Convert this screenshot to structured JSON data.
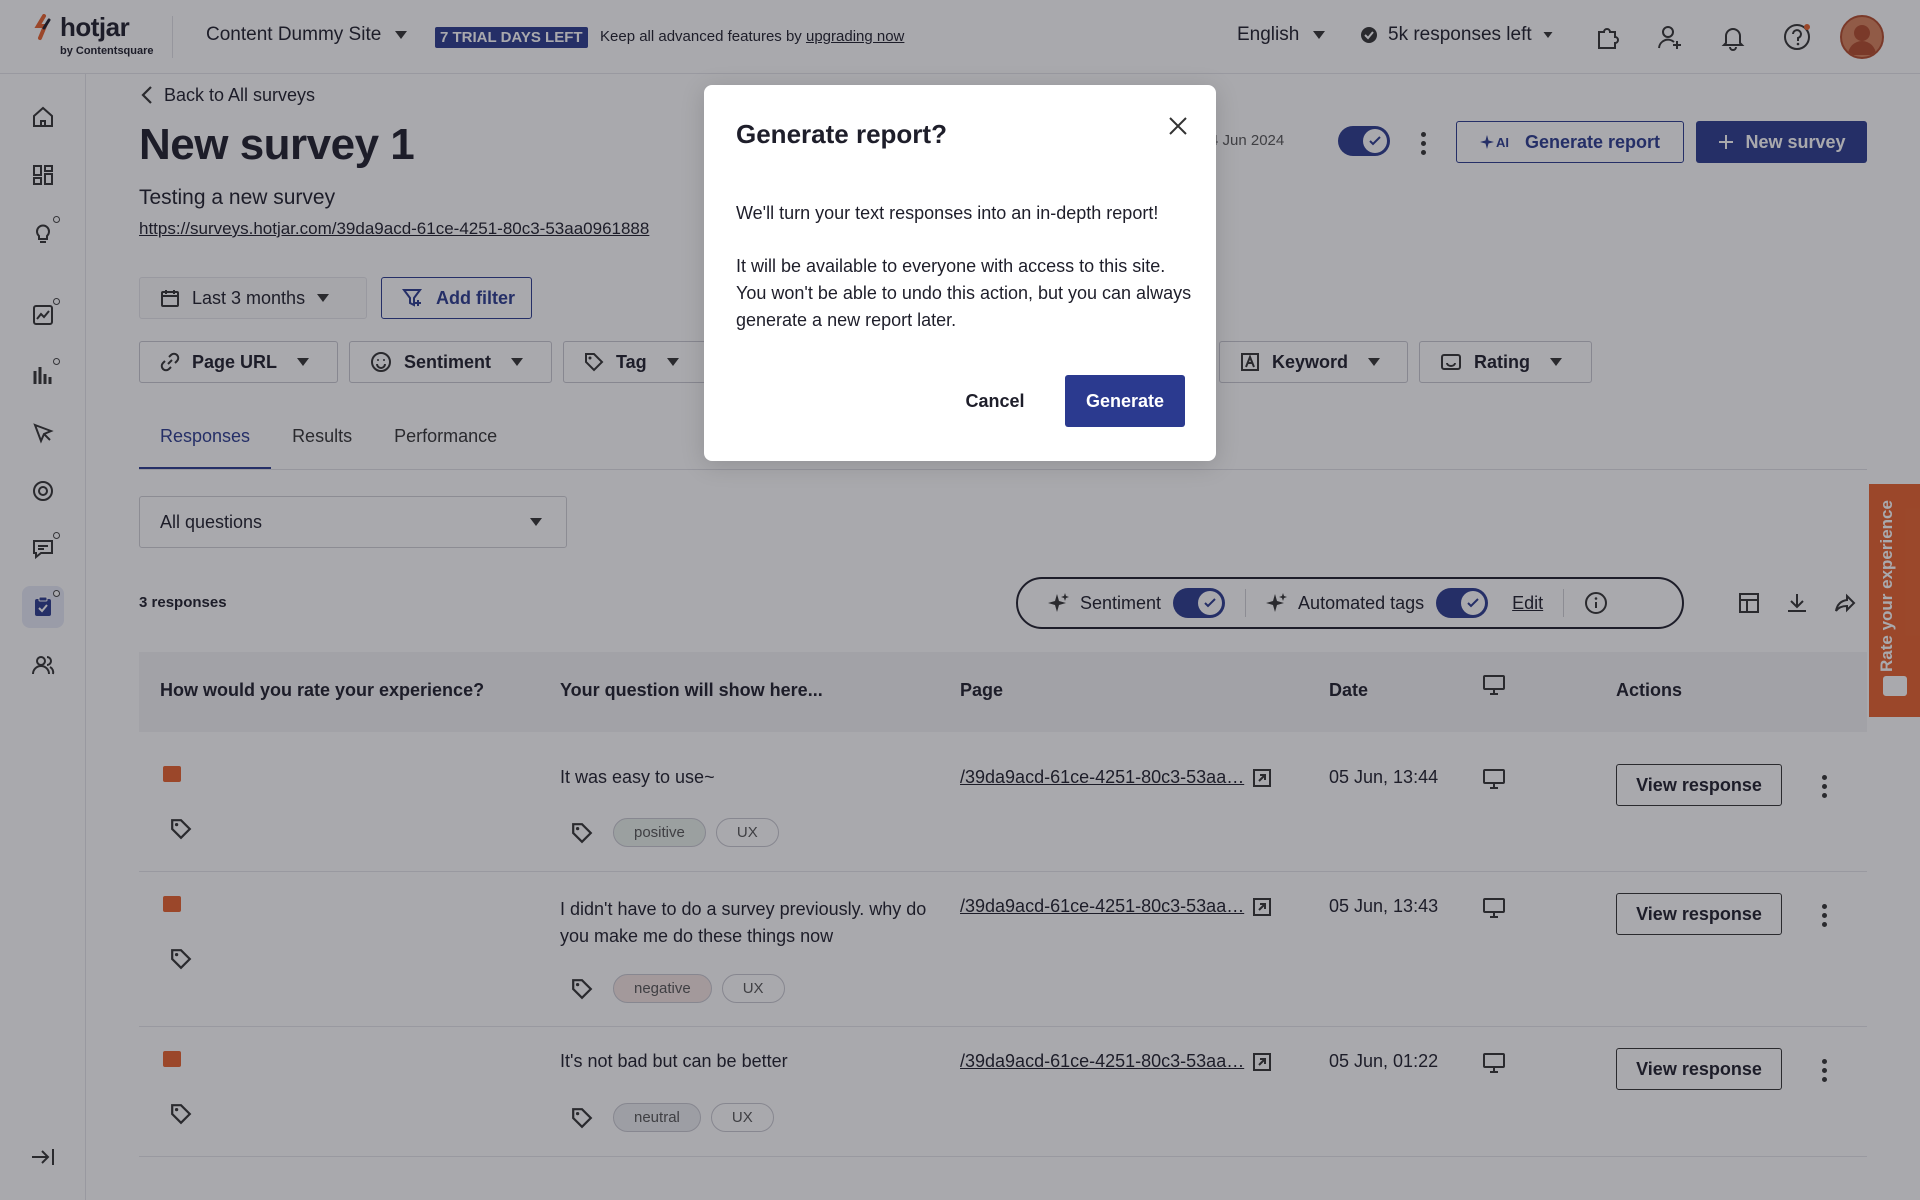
{
  "topbar": {
    "brand": "hotjar",
    "brand_sub": "by Contentsquare",
    "site_name": "Content Dummy Site",
    "trial_badge": "7 TRIAL DAYS LEFT",
    "trial_text": "Keep all advanced features by ",
    "trial_link": "upgrading now",
    "language": "English",
    "responses_left": "5k responses left"
  },
  "survey": {
    "back_label": "Back to All surveys",
    "title": "New survey 1",
    "subtitle": "Testing a new survey",
    "url": "https://surveys.hotjar.com/39da9acd-61ce-4251-80c3-53aa0961888",
    "date_fragment": "4 Jun 2024",
    "generate_report_label": "Generate report",
    "ai_label": "AI",
    "new_survey_label": "New survey"
  },
  "filters": {
    "date_range": "Last 3 months",
    "add_filter": "Add filter",
    "chips": [
      "Page URL",
      "Sentiment",
      "Tag",
      "Keyword",
      "Rating"
    ]
  },
  "tabs": [
    "Responses",
    "Results",
    "Performance"
  ],
  "questions_select": "All questions",
  "responses_count": "3 responses",
  "toggles": {
    "sentiment": "Sentiment",
    "automated_tags": "Automated tags",
    "edit": "Edit"
  },
  "table": {
    "headers": [
      "How would you rate your experience?",
      "Your question will show here...",
      "Page",
      "Date",
      "Actions"
    ],
    "rows": [
      {
        "answer": "It was easy to use~",
        "tags": [
          "positive",
          "UX"
        ],
        "page": "/39da9acd-61ce-4251-80c3-53aa…",
        "date": "05 Jun, 13:44",
        "action": "View response"
      },
      {
        "answer": "I didn't have to do a survey previously. why do you make me do these things now",
        "tags": [
          "negative",
          "UX"
        ],
        "page": "/39da9acd-61ce-4251-80c3-53aa…",
        "date": "05 Jun, 13:43",
        "action": "View response"
      },
      {
        "answer": "It's not bad but can be better",
        "tags": [
          "neutral",
          "UX"
        ],
        "page": "/39da9acd-61ce-4251-80c3-53aa…",
        "date": "05 Jun, 01:22",
        "action": "View response"
      }
    ]
  },
  "rate_tab": "Rate your experience",
  "modal": {
    "title": "Generate report?",
    "p1": "We'll turn your text responses into an in-depth report!",
    "p2": "It will be available to everyone with access to this site. You won't be able to undo this action, but you can always generate a new report later.",
    "cancel": "Cancel",
    "generate": "Generate"
  },
  "colors": {
    "primary": "#2b3a8f",
    "accent_orange": "#e8622d",
    "text": "#1e1e2a"
  },
  "icons": [
    "hotjar-logo-icon",
    "chevron-down-icon",
    "check-circle-icon",
    "puzzle-icon",
    "add-user-icon",
    "bell-icon",
    "help-icon",
    "home-icon",
    "dashboard-icon",
    "lightbulb-icon",
    "trends-icon",
    "heatmap-icon",
    "recordings-icon",
    "feedback-icon",
    "interviews-icon",
    "surveys-icon",
    "users-icon",
    "calendar-icon",
    "filter-icon",
    "link-icon",
    "smile-icon",
    "tag-icon",
    "keyword-icon",
    "rating-icon",
    "sparkle-icon",
    "info-icon",
    "table-icon",
    "download-icon",
    "share-icon",
    "external-link-icon",
    "desktop-icon",
    "close-icon",
    "collapse-icon"
  ]
}
